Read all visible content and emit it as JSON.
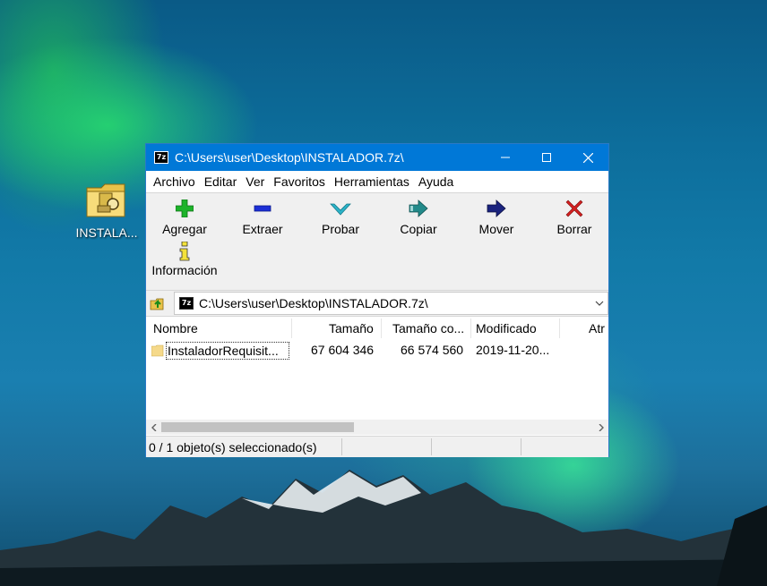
{
  "desktop": {
    "icon_label": "INSTALA..."
  },
  "window": {
    "app_icon_text": "7z",
    "title": "C:\\Users\\user\\Desktop\\INSTALADOR.7z\\",
    "controls": {
      "minimize": "minimize-icon",
      "maximize": "maximize-icon",
      "close": "close-icon"
    }
  },
  "menu": [
    "Archivo",
    "Editar",
    "Ver",
    "Favoritos",
    "Herramientas",
    "Ayuda"
  ],
  "toolbar": {
    "add": "Agregar",
    "extract": "Extraer",
    "test": "Probar",
    "copy": "Copiar",
    "move": "Mover",
    "delete": "Borrar",
    "info": "Información"
  },
  "address": {
    "path": "C:\\Users\\user\\Desktop\\INSTALADOR.7z\\"
  },
  "list": {
    "columns": [
      "Nombre",
      "Tamaño",
      "Tamaño co...",
      "Modificado",
      "Atr"
    ],
    "rows": [
      {
        "name": "InstaladorRequisit...",
        "size": "67 604 346",
        "packed": "66 574 560",
        "modified": "2019-11-20..."
      }
    ]
  },
  "status": {
    "text": "0 / 1 objeto(s) seleccionado(s)"
  },
  "colors": {
    "titlebar": "#0078d7",
    "add_icon": "#1db32a",
    "extract_icon": "#1c2fd6",
    "test_icon": "#2bb3c8",
    "copy_icon": "#238a8a",
    "move_icon": "#1a237e",
    "delete_icon": "#d32020"
  }
}
